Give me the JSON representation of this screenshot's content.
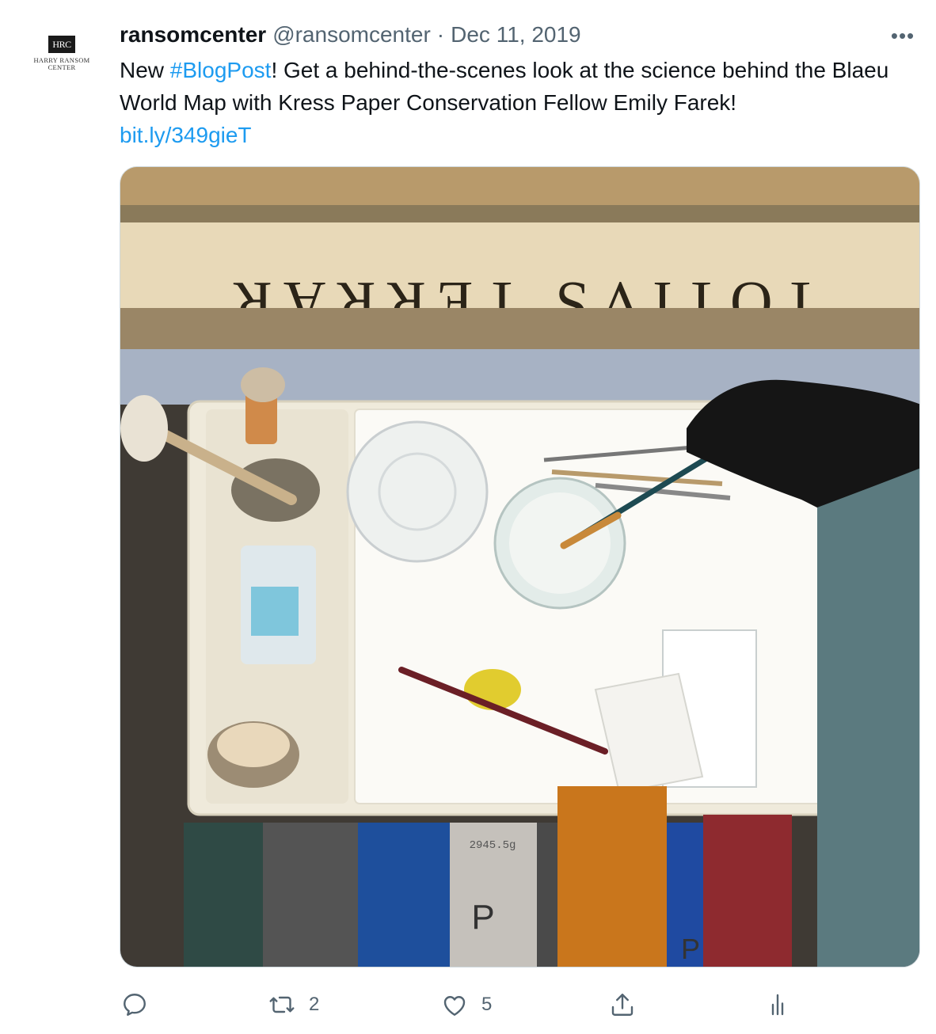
{
  "avatar": {
    "logo_text": "HRC",
    "logo_name_line1": "HARRY RANSOM",
    "logo_name_line2": "CENTER"
  },
  "tweet": {
    "display_name": "ransomcenter",
    "handle": "@ransomcenter",
    "separator": "·",
    "date": "Dec 11, 2019",
    "more_label": "•••",
    "text_part1": "New ",
    "hashtag": "#BlogPost",
    "text_part2": "! Get a behind-the-scenes look at the science behind the Blaeu World Map with Kress Paper Conservation Fellow Emily Farek!",
    "link": "bit.ly/349gieT"
  },
  "photo": {
    "map_lettering": "TOTIVS TERRAR",
    "weight_label": "2945.5g",
    "weight_letter_main": "P",
    "weight_letter_small": "P"
  },
  "actions": {
    "reply_icon": "reply-icon",
    "retweet_icon": "retweet-icon",
    "retweet_count": "2",
    "like_icon": "heart-icon",
    "like_count": "5",
    "share_icon": "share-icon",
    "analytics_icon": "analytics-icon"
  }
}
